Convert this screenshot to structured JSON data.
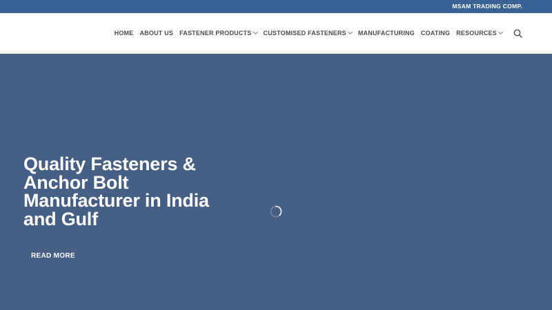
{
  "topbar": {
    "company": "MSAM TRADING COMP."
  },
  "nav": {
    "items": [
      {
        "label": "HOME",
        "dropdown": false
      },
      {
        "label": "ABOUT US",
        "dropdown": false
      },
      {
        "label": "FASTENER PRODUCTS",
        "dropdown": true
      },
      {
        "label": "CUSTOMISED FASTENERS",
        "dropdown": true
      },
      {
        "label": "MANUFACTURING",
        "dropdown": false
      },
      {
        "label": "COATING",
        "dropdown": false
      },
      {
        "label": "RESOURCES",
        "dropdown": true
      }
    ],
    "search_icon": "search-icon"
  },
  "hero": {
    "title": "Quality Fasteners & Anchor Bolt Manufacturer in India and Gulf",
    "button_label": "READ MORE",
    "loading_icon": "loading-spinner-icon"
  },
  "colors": {
    "topbar_bg": "#3a6395",
    "hero_bg": "#465f85",
    "nav_text": "#4a4a4a",
    "white": "#ffffff"
  }
}
